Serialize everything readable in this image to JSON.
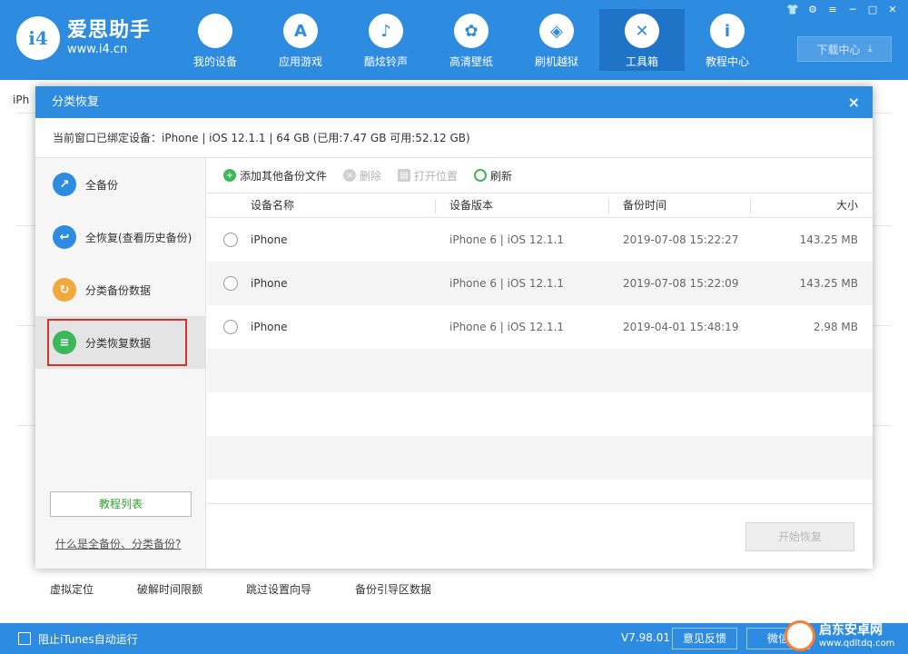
{
  "app": {
    "name": "爱思助手",
    "url": "www.i4.cn",
    "logo_mark": "i4"
  },
  "nav": [
    {
      "label": "我的设备",
      "icon": "apple-icon",
      "glyph": ""
    },
    {
      "label": "应用游戏",
      "icon": "app-store-icon",
      "glyph": "A"
    },
    {
      "label": "酷炫铃声",
      "icon": "bell-icon",
      "glyph": "♪"
    },
    {
      "label": "高清壁纸",
      "icon": "flower-icon",
      "glyph": "✿"
    },
    {
      "label": "刷机越狱",
      "icon": "box-icon",
      "glyph": "◈"
    },
    {
      "label": "工具箱",
      "icon": "tools-icon",
      "glyph": "✕"
    },
    {
      "label": "教程中心",
      "icon": "info-icon",
      "glyph": "i"
    }
  ],
  "window_controls": {
    "shirt": "👕",
    "settings": "⚙",
    "menu": "≡",
    "minimize": "─",
    "maximize": "□",
    "close": "✕"
  },
  "download_center": {
    "label": "下载中心",
    "icon": "⤓"
  },
  "background": {
    "tab_label": "iPh",
    "tools": [
      "虚拟定位",
      "破解时间限额",
      "跳过设置向导",
      "备份引导区数据"
    ]
  },
  "statusbar": {
    "itunes_label": "阻止iTunes自动运行",
    "version": "V7.98.01",
    "feedback": "意见反馈",
    "wechat": "微信"
  },
  "watermark": {
    "title": "启东安卓网",
    "url": "www.qdltdq.com"
  },
  "dialog": {
    "title": "分类恢复",
    "close": "×",
    "device_info": "当前窗口已绑定设备：iPhone  |  iOS 12.1.1  |  64 GB (已用:7.47 GB 可用:52.12 GB)",
    "sidebar": [
      {
        "label": "全备份",
        "color": "#2d8be0",
        "glyph": "↗"
      },
      {
        "label": "全恢复(查看历史备份)",
        "color": "#2d8be0",
        "glyph": "↩"
      },
      {
        "label": "分类备份数据",
        "color": "#f2a93b",
        "glyph": "↻"
      },
      {
        "label": "分类恢复数据",
        "color": "#3cb85a",
        "glyph": "≡"
      }
    ],
    "tutorial_button": "教程列表",
    "help_link": "什么是全备份、分类备份?",
    "toolbar": {
      "add": "添加其他备份文件",
      "delete": "删除",
      "open_location": "打开位置",
      "refresh": "刷新"
    },
    "columns": {
      "name": "设备名称",
      "version": "设备版本",
      "time": "备份时间",
      "size": "大小"
    },
    "rows": [
      {
        "name": "iPhone",
        "version": "iPhone 6 | iOS 12.1.1",
        "time": "2019-07-08 15:22:27",
        "size": "143.25 MB"
      },
      {
        "name": "iPhone",
        "version": "iPhone 6 | iOS 12.1.1",
        "time": "2019-07-08 15:22:09",
        "size": "143.25 MB"
      },
      {
        "name": "iPhone",
        "version": "iPhone 6 | iOS 12.1.1",
        "time": "2019-04-01 15:48:19",
        "size": "2.98 MB"
      }
    ],
    "start_button": "开始恢复"
  }
}
